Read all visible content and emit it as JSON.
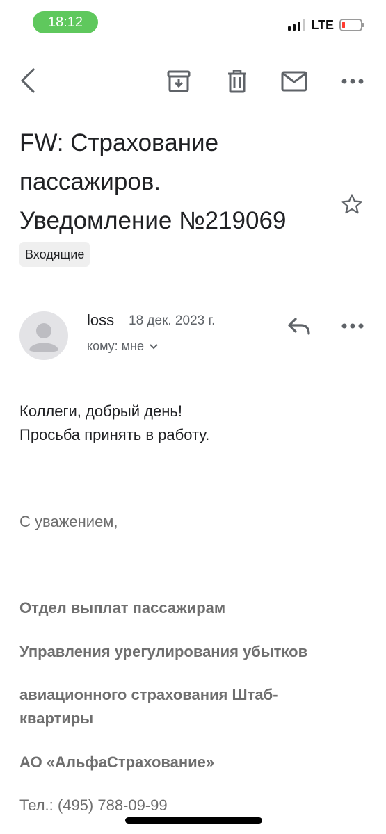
{
  "status_bar": {
    "time": "18:12",
    "network": "LTE",
    "battery_level": 0.15,
    "signal_bars": 3
  },
  "toolbar": {
    "back_icon": "chevron-left-icon",
    "archive_icon": "archive-icon",
    "delete_icon": "trash-icon",
    "mark_unread_icon": "mail-icon",
    "more_icon": "more-horizontal-icon"
  },
  "email": {
    "subject_line1": "FW: Страхование",
    "subject_line2": "пассажиров.",
    "subject_line3": "Уведомление №219069",
    "label": "Входящие",
    "starred": false,
    "sender": "loss",
    "date": "18 дек. 2023 г.",
    "recipient": "кому: мне",
    "body": [
      "Коллеги, добрый день!",
      "Просьба принять в работу."
    ],
    "greeting": "С уважением,",
    "signature": [
      "Отдел выплат пассажирам",
      "Управления урегулирования убытков",
      "авиационного страхования Штаб-",
      "квартиры",
      "АО «АльфаСтрахование»"
    ],
    "phone": "Тел.: (495) 788-09-99"
  },
  "colors": {
    "time_pill": "#5fc85d",
    "battery_low": "#ff3b30",
    "icon": "#5f6368",
    "signature_text": "#6f6f6f"
  }
}
